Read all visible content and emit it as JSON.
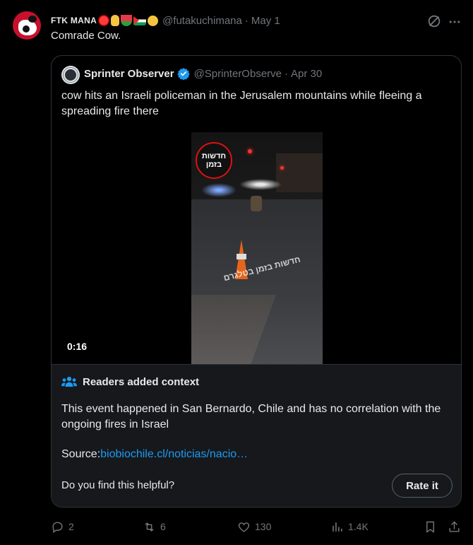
{
  "tweet": {
    "author_name": "FTK MANA",
    "emoji_icons": [
      "red-circle-icon",
      "rock-hand-icon",
      "watermelon-icon",
      "palestine-flag-icon",
      "raised-fist-icon"
    ],
    "handle": "@futakuchimana",
    "separator": "·",
    "date": "May 1",
    "text": "Comrade Cow."
  },
  "quote": {
    "author_name": "Sprinter Observer",
    "handle": "@SprinterObserve",
    "separator": "·",
    "date": "Apr 30",
    "text": "cow hits an Israeli policeman in the Jerusalem mountains while fleeing a spreading fire there",
    "video": {
      "duration": "0:16",
      "logo_line1": "חדשות",
      "logo_line2": "בזמן",
      "watermark": "חדשות בזמן בטלגרם"
    }
  },
  "context": {
    "title": "Readers added context",
    "body": "This event happened in San Bernardo, Chile and has no correlation with the ongoing fires in Israel",
    "source_label": "Source:",
    "source_link": "biobiochile.cl/noticias/nacio…",
    "question": "Do you find this helpful?",
    "rate_button": "Rate it"
  },
  "actions": {
    "replies": "2",
    "reposts": "6",
    "likes": "130",
    "views": "1.4K"
  },
  "colors": {
    "background": "#000000",
    "text": "#e7e9ea",
    "muted": "#71767b",
    "link": "#1d9bf0",
    "verified": "#1d9bf0",
    "context_bg": "#16181c"
  }
}
